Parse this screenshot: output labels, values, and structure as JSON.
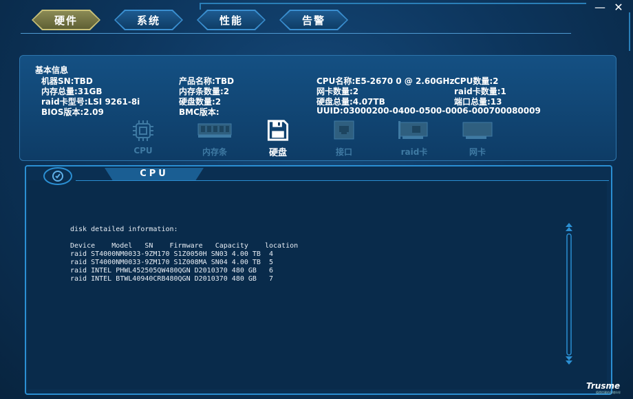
{
  "window": {
    "minimize_glyph": "—",
    "close_glyph": "✕"
  },
  "tabs": [
    {
      "label": "硬件",
      "active": true
    },
    {
      "label": "系统",
      "active": false
    },
    {
      "label": "性能",
      "active": false
    },
    {
      "label": "告警",
      "active": false
    }
  ],
  "basic_info": {
    "title": "基本信息",
    "col1": [
      "机器SN:TBD",
      "内存总量:31GB",
      "raid卡型号:LSI 9261-8i",
      "BIOS版本:2.09"
    ],
    "col2": [
      "产品名称:TBD",
      "内存条数量:2",
      "硬盘数量:2",
      "BMC版本:"
    ],
    "col3": [
      "CPU名称:E5-2670 0 @ 2.60GHz",
      "网卡数量:2",
      "硬盘总量:4.07TB",
      "UUID:03000200-0400-0500-0006-000700080009"
    ],
    "col4": [
      "CPU数量:2",
      "raid卡数量:1",
      "端口总量:13"
    ]
  },
  "hardware_icons": [
    {
      "label": "CPU",
      "icon": "cpu-icon",
      "active": false
    },
    {
      "label": "内存条",
      "icon": "memory-icon",
      "active": false
    },
    {
      "label": "硬盘",
      "icon": "disk-icon",
      "active": true
    },
    {
      "label": "接口",
      "icon": "port-icon",
      "active": false
    },
    {
      "label": "raid卡",
      "icon": "raid-card-icon",
      "active": false
    },
    {
      "label": "网卡",
      "icon": "nic-icon",
      "active": false
    }
  ],
  "detail": {
    "header": "CPU",
    "text": "disk detailed information:\n\nDevice    Model   SN    Firmware   Capacity    location\nraid ST4000NM0033-9ZM170 S1Z0050H SN03 4.00 TB  4\nraid ST4000NM0033-9ZM170 S1Z008MA SN04 4.00 TB  5\nraid INTEL PHWL452505QW480QGN D2010370 480 GB   6\nraid INTEL BTWL40940CRB480QGN D2010370 480 GB   7"
  },
  "brand": {
    "name": "Trusme",
    "tagline": "值得信赖的存储伙伴"
  },
  "colors": {
    "active_tab": "#8a8a55",
    "accent": "#2b8fd3",
    "background": "#0b2f52"
  }
}
